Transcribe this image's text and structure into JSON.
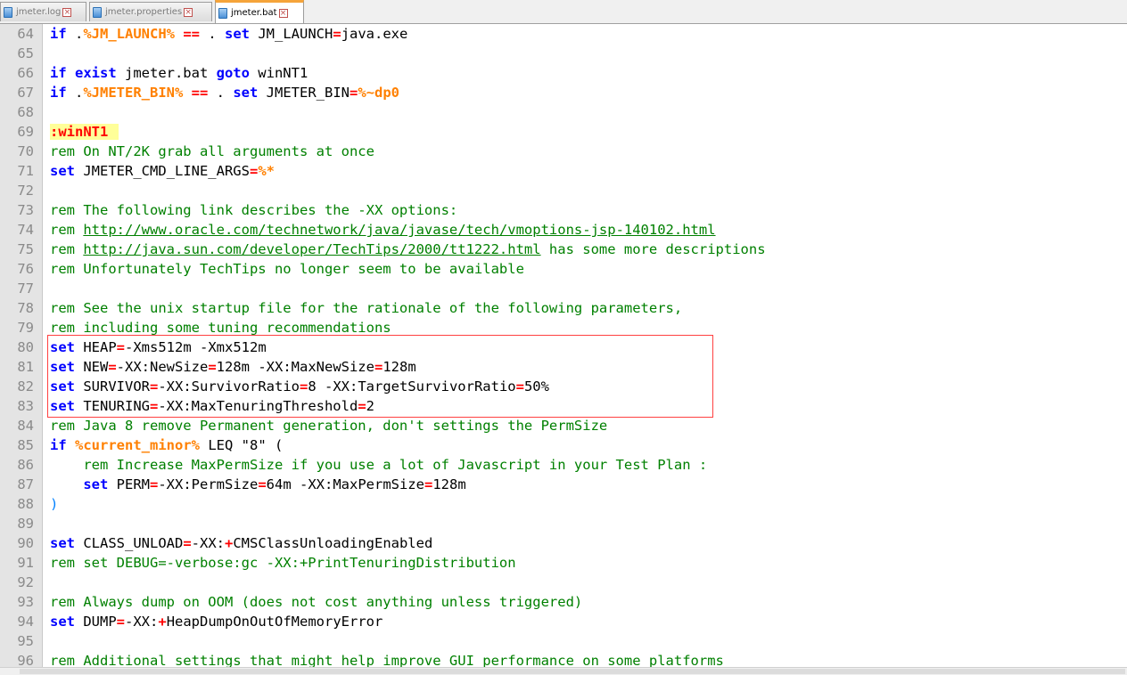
{
  "tabs": [
    {
      "label": "jmeter.log",
      "active": false
    },
    {
      "label": "jmeter.properties",
      "active": false
    },
    {
      "label": "jmeter.bat",
      "active": true
    }
  ],
  "colors": {
    "keyword": "#0000ff",
    "operator": "#ff0000",
    "variable": "#ff8000",
    "comment": "#008000",
    "line_number": "#8a8a8a",
    "label_highlight": "#ffff99"
  },
  "editor": {
    "lines": [
      {
        "n": "64",
        "tokens": [
          [
            "kw",
            "if"
          ],
          [
            "txt",
            " ."
          ],
          [
            "var",
            "%JM_LAUNCH%"
          ],
          [
            "txt",
            " "
          ],
          [
            "op",
            "=="
          ],
          [
            "txt",
            " . "
          ],
          [
            "kw",
            "set"
          ],
          [
            "txt",
            " JM_LAUNCH"
          ],
          [
            "op",
            "="
          ],
          [
            "txt",
            "java.exe"
          ]
        ]
      },
      {
        "n": "65",
        "tokens": []
      },
      {
        "n": "66",
        "tokens": [
          [
            "kw",
            "if exist"
          ],
          [
            "txt",
            " jmeter.bat "
          ],
          [
            "kw",
            "goto"
          ],
          [
            "txt",
            " winNT1"
          ]
        ]
      },
      {
        "n": "67",
        "tokens": [
          [
            "kw",
            "if"
          ],
          [
            "txt",
            " ."
          ],
          [
            "var",
            "%JMETER_BIN%"
          ],
          [
            "txt",
            " "
          ],
          [
            "op",
            "=="
          ],
          [
            "txt",
            " . "
          ],
          [
            "kw",
            "set"
          ],
          [
            "txt",
            " JMETER_BIN"
          ],
          [
            "op",
            "="
          ],
          [
            "var",
            "%~dp0"
          ]
        ]
      },
      {
        "n": "68",
        "tokens": []
      },
      {
        "n": "69",
        "tokens": [
          [
            "labelhl",
            ":winNT1"
          ]
        ]
      },
      {
        "n": "70",
        "tokens": [
          [
            "cm",
            "rem On NT/2K grab all arguments at once"
          ]
        ]
      },
      {
        "n": "71",
        "tokens": [
          [
            "kw",
            "set"
          ],
          [
            "txt",
            " JMETER_CMD_LINE_ARGS"
          ],
          [
            "op",
            "="
          ],
          [
            "var",
            "%*"
          ]
        ]
      },
      {
        "n": "72",
        "tokens": []
      },
      {
        "n": "73",
        "tokens": [
          [
            "cm",
            "rem The following link describes the -XX options:"
          ]
        ]
      },
      {
        "n": "74",
        "tokens": [
          [
            "cm",
            "rem "
          ],
          [
            "link",
            "http://www.oracle.com/technetwork/java/javase/tech/vmoptions-jsp-140102.html"
          ]
        ]
      },
      {
        "n": "75",
        "tokens": [
          [
            "cm",
            "rem "
          ],
          [
            "link",
            "http://java.sun.com/developer/TechTips/2000/tt1222.html"
          ],
          [
            "cm",
            " has some more descriptions"
          ]
        ]
      },
      {
        "n": "76",
        "tokens": [
          [
            "cm",
            "rem Unfortunately TechTips no longer seem to be available"
          ]
        ]
      },
      {
        "n": "77",
        "tokens": []
      },
      {
        "n": "78",
        "tokens": [
          [
            "cm",
            "rem See the unix startup file for the rationale of the following parameters,"
          ]
        ]
      },
      {
        "n": "79",
        "tokens": [
          [
            "cm",
            "rem including some tuning recommendations"
          ]
        ]
      },
      {
        "n": "80",
        "tokens": [
          [
            "kw",
            "set"
          ],
          [
            "txt",
            " HEAP"
          ],
          [
            "op",
            "="
          ],
          [
            "txt",
            "-Xms512m -Xmx512m"
          ]
        ]
      },
      {
        "n": "81",
        "tokens": [
          [
            "kw",
            "set"
          ],
          [
            "txt",
            " NEW"
          ],
          [
            "op",
            "="
          ],
          [
            "txt",
            "-XX:NewSize"
          ],
          [
            "op",
            "="
          ],
          [
            "txt",
            "128m -XX:MaxNewSize"
          ],
          [
            "op",
            "="
          ],
          [
            "txt",
            "128m"
          ]
        ]
      },
      {
        "n": "82",
        "tokens": [
          [
            "kw",
            "set"
          ],
          [
            "txt",
            " SURVIVOR"
          ],
          [
            "op",
            "="
          ],
          [
            "txt",
            "-XX:SurvivorRatio"
          ],
          [
            "op",
            "="
          ],
          [
            "txt",
            "8 -XX:TargetSurvivorRatio"
          ],
          [
            "op",
            "="
          ],
          [
            "txt",
            "50%"
          ]
        ]
      },
      {
        "n": "83",
        "tokens": [
          [
            "kw",
            "set"
          ],
          [
            "txt",
            " TENURING"
          ],
          [
            "op",
            "="
          ],
          [
            "txt",
            "-XX:MaxTenuringThreshold"
          ],
          [
            "op",
            "="
          ],
          [
            "txt",
            "2"
          ]
        ]
      },
      {
        "n": "84",
        "tokens": [
          [
            "cm",
            "rem Java 8 remove Permanent generation, don't settings the PermSize"
          ]
        ]
      },
      {
        "n": "85",
        "tokens": [
          [
            "kw",
            "if"
          ],
          [
            "txt",
            " "
          ],
          [
            "var",
            "%current_minor%"
          ],
          [
            "txt",
            " LEQ \"8\" ("
          ]
        ]
      },
      {
        "n": "86",
        "tokens": [
          [
            "cm",
            "    rem Increase MaxPermSize if you use a lot of Javascript in your Test Plan :"
          ]
        ]
      },
      {
        "n": "87",
        "tokens": [
          [
            "txt",
            "    "
          ],
          [
            "kw",
            "set"
          ],
          [
            "txt",
            " PERM"
          ],
          [
            "op",
            "="
          ],
          [
            "txt",
            "-XX:PermSize"
          ],
          [
            "op",
            "="
          ],
          [
            "txt",
            "64m -XX:MaxPermSize"
          ],
          [
            "op",
            "="
          ],
          [
            "txt",
            "128m"
          ]
        ]
      },
      {
        "n": "88",
        "tokens": [
          [
            "paren",
            ")"
          ]
        ]
      },
      {
        "n": "89",
        "tokens": []
      },
      {
        "n": "90",
        "tokens": [
          [
            "kw",
            "set"
          ],
          [
            "txt",
            " CLASS_UNLOAD"
          ],
          [
            "op",
            "="
          ],
          [
            "txt",
            "-XX:"
          ],
          [
            "op",
            "+"
          ],
          [
            "txt",
            "CMSClassUnloadingEnabled"
          ]
        ]
      },
      {
        "n": "91",
        "tokens": [
          [
            "cm",
            "rem set DEBUG=-verbose:gc -XX:+PrintTenuringDistribution"
          ]
        ]
      },
      {
        "n": "92",
        "tokens": []
      },
      {
        "n": "93",
        "tokens": [
          [
            "cm",
            "rem Always dump on OOM (does not cost anything unless triggered)"
          ]
        ]
      },
      {
        "n": "94",
        "tokens": [
          [
            "kw",
            "set"
          ],
          [
            "txt",
            " DUMP"
          ],
          [
            "op",
            "="
          ],
          [
            "txt",
            "-XX:"
          ],
          [
            "op",
            "+"
          ],
          [
            "txt",
            "HeapDumpOnOutOfMemoryError"
          ]
        ]
      },
      {
        "n": "95",
        "tokens": []
      },
      {
        "n": "96",
        "tokens": [
          [
            "cm",
            "rem Additional settings that might help improve GUI performance on some platforms"
          ]
        ]
      }
    ]
  }
}
